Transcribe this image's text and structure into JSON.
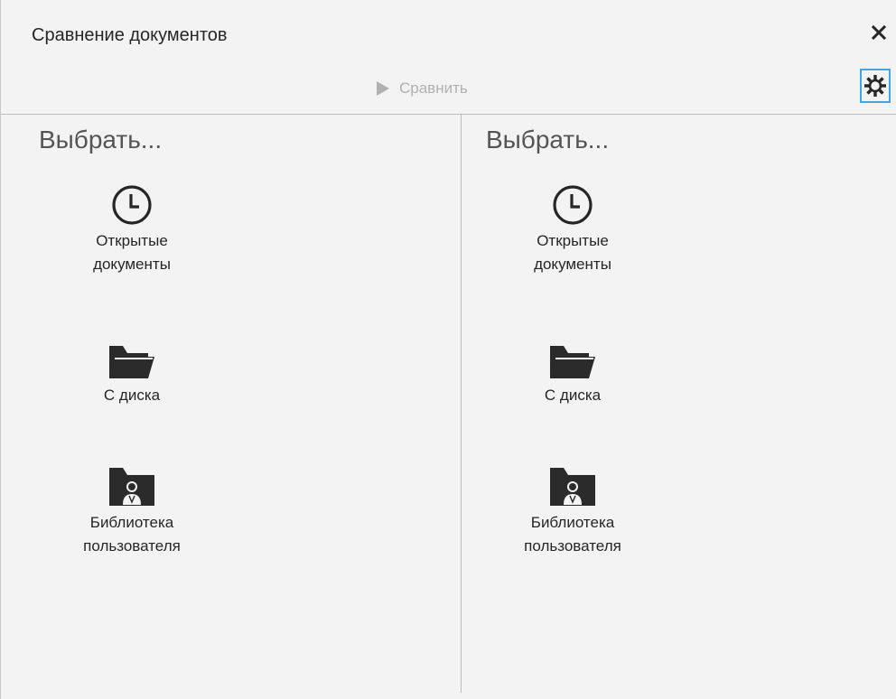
{
  "window": {
    "title": "Сравнение документов",
    "close_label": "✕"
  },
  "toolbar": {
    "compare_label": "Сравнить"
  },
  "panes": [
    {
      "heading": "Выбрать...",
      "options": [
        {
          "label_line1": "Открытые",
          "label_line2": "документы",
          "icon": "clock-icon"
        },
        {
          "label_line1": "С диска",
          "label_line2": "",
          "icon": "folder-icon"
        },
        {
          "label_line1": "Библиотека",
          "label_line2": "пользователя",
          "icon": "user-library-icon"
        }
      ]
    },
    {
      "heading": "Выбрать...",
      "options": [
        {
          "label_line1": "Открытые",
          "label_line2": "документы",
          "icon": "clock-icon"
        },
        {
          "label_line1": "С диска",
          "label_line2": "",
          "icon": "folder-icon"
        },
        {
          "label_line1": "Библиотека",
          "label_line2": "пользователя",
          "icon": "user-library-icon"
        }
      ]
    }
  ],
  "colors": {
    "accent": "#4aa3df",
    "background": "#f3f3f3",
    "disabled_text": "#b0b0b0"
  }
}
